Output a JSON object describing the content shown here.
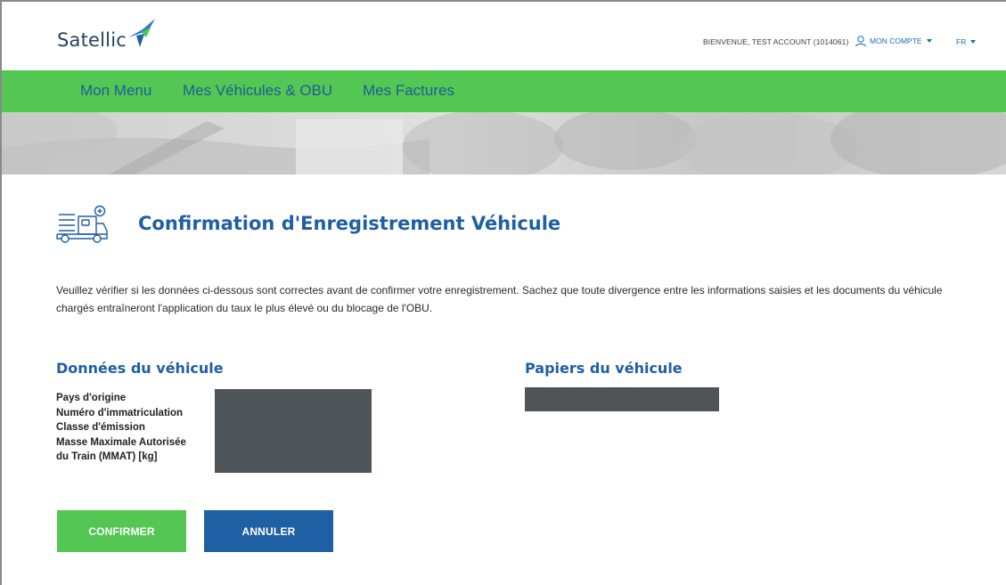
{
  "header": {
    "logo_text": "Satellic",
    "welcome": "BIENVENUE, TEST ACCOUNT (1014061)",
    "account_label": "MON COMPTE",
    "language": "FR"
  },
  "nav": {
    "items": [
      "Mon Menu",
      "Mes Véhicules & OBU",
      "Mes Factures"
    ]
  },
  "page": {
    "title": "Confirmation d'Enregistrement Véhicule",
    "intro": "Veuillez vérifier si les données ci-dessous sont correctes avant de confirmer votre enregistrement. Sachez que toute divergence entre les informations saisies et les documents du véhicule chargés entraîneront l'application du taux le plus élevé ou du blocage de l'OBU."
  },
  "vehicle_data": {
    "title": "Données du véhicule",
    "labels": [
      "Pays d'origine",
      "Numéro d'immatriculation",
      "Classe d'émission",
      "Masse Maximale Autorisée",
      "du Train (MMAT) [kg]"
    ]
  },
  "vehicle_papers": {
    "title": "Papiers du véhicule"
  },
  "actions": {
    "confirm": "CONFIRMER",
    "cancel": "ANNULER"
  },
  "colors": {
    "brand_green": "#53c653",
    "brand_blue": "#1f5fa3",
    "link_blue": "#1e6bb8",
    "redaction": "#4f5459"
  },
  "icons": {
    "logo": "satellic-bird-logo",
    "account": "user-icon",
    "page": "truck-document-icon"
  }
}
